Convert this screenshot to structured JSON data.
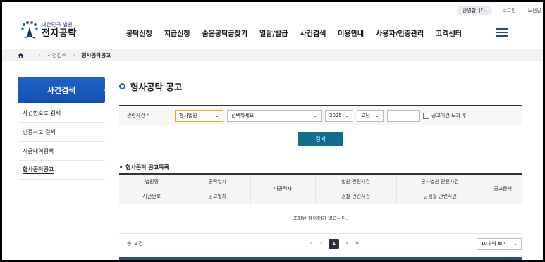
{
  "util": {
    "welcome": "환영합니다.",
    "login": "로그인",
    "help": "도움말"
  },
  "logo": {
    "sub": "대한민국 법원",
    "main": "전자공탁"
  },
  "gnb": [
    "공탁신청",
    "지급신청",
    "숨은공탁금찾기",
    "열람/발급",
    "사건검색",
    "이용안내",
    "사용자/인증관리",
    "고객센터"
  ],
  "breadcrumb": {
    "home_icon": "home-icon",
    "level1": "사건검색",
    "level2": "형사공탁공고"
  },
  "sidebar": {
    "title": "사건검색",
    "items": [
      {
        "label": "사건번호로 검색"
      },
      {
        "label": "인증서로 검색"
      },
      {
        "label": "지급내역검색"
      },
      {
        "label": "형사공탁공고"
      }
    ],
    "active_index": 3
  },
  "main": {
    "title": "형사공탁 공고",
    "search": {
      "label": "관련사건",
      "required_mark": "*",
      "case_type_value": "형사법원",
      "court_placeholder": "선택하세요.",
      "year_value": "2025",
      "court_level_value": "고단",
      "case_number_value": "",
      "period_checkbox_label": "공고기간 도과 후",
      "search_button": "검색"
    },
    "list_title": "형사공탁 공고목록",
    "table": {
      "row1": [
        "법원명",
        "공탁일자",
        "피공탁자",
        "법원 관련사건",
        "군사법원 관련사건",
        "공고문서"
      ],
      "row2": [
        "사건번호",
        "공고일자",
        "검찰 관련사건",
        "군검찰 관련사건"
      ],
      "empty_message": "조회된 데이터가 없습니다."
    },
    "total": {
      "prefix": "총",
      "count": "0",
      "suffix": "건"
    },
    "pager": {
      "first": "«",
      "prev": "‹",
      "current": "1",
      "next": "›",
      "last": "»"
    },
    "per_page": "10개씩 보기"
  },
  "colors": {
    "primary": "#1f63c8",
    "search_button": "#0f6e8c",
    "required": "#e03a3a"
  }
}
